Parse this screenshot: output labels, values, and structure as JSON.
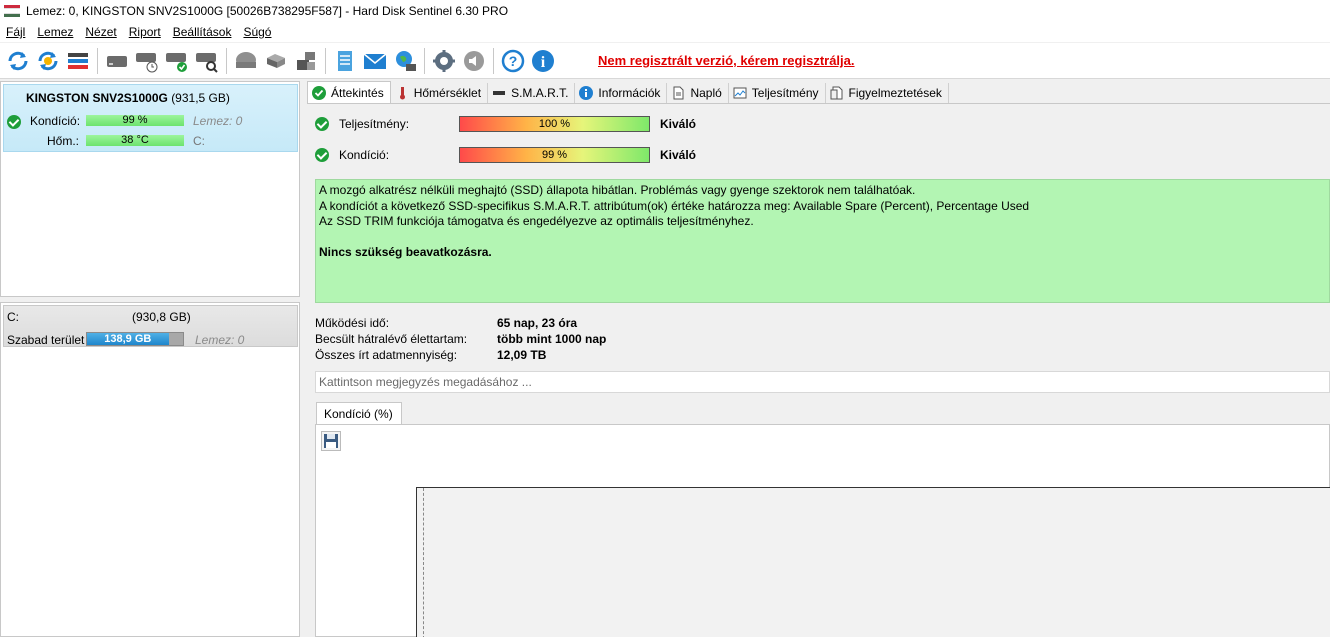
{
  "window": {
    "title": "Lemez: 0, KINGSTON SNV2S1000G [50026B738295F587]  -  Hard Disk Sentinel 6.30 PRO",
    "flag_colors": [
      "#cd2a3e",
      "#ffffff",
      "#436f4d"
    ]
  },
  "menu": [
    "Fájl",
    "Lemez",
    "Nézet",
    "Riport",
    "Beállítások",
    "Súgó"
  ],
  "toolbar": {
    "buttons": [
      "refresh-icon",
      "refresh-all-icon",
      "disk-list-icon",
      "hdd-icon",
      "hdd-clock-icon",
      "hdd-check-icon",
      "hdd-search-icon",
      "hdd-gray-icon",
      "drive-icon",
      "drive-stack-icon",
      "notepad-icon",
      "mail-icon",
      "network-icon",
      "settings-icon",
      "sound-icon",
      "help-icon",
      "info-icon"
    ],
    "registration_notice": "Nem regisztrált verzió, kérem regisztrálja."
  },
  "disk_panel": {
    "name": "KINGSTON SNV2S1000G",
    "size": "(931,5 GB)",
    "health_label": "Kondíció:",
    "health_value": "99 %",
    "health_disk": "Lemez: 0",
    "temp_label": "Hőm.:",
    "temp_value": "38 °C",
    "temp_drive": "C:"
  },
  "volume_panel": {
    "drive": "C:",
    "size": "(930,8 GB)",
    "free_label": "Szabad terület",
    "free_value": "138,9 GB",
    "free_disk": "Lemez: 0",
    "free_fraction": 0.85
  },
  "tabs": [
    {
      "label": "Áttekintés",
      "icon": "check-icon"
    },
    {
      "label": "Hőmérséklet",
      "icon": "thermometer-icon"
    },
    {
      "label": "S.M.A.R.T.",
      "icon": "smart-icon"
    },
    {
      "label": "Információk",
      "icon": "info-icon"
    },
    {
      "label": "Napló",
      "icon": "log-icon"
    },
    {
      "label": "Teljesítmény",
      "icon": "performance-icon"
    },
    {
      "label": "Figyelmeztetések",
      "icon": "alerts-icon"
    }
  ],
  "overview": {
    "performance_label": "Teljesítmény:",
    "performance_value": "100 %",
    "performance_rating": "Kiváló",
    "health_label": "Kondíció:",
    "health_value": "99 %",
    "health_rating": "Kiváló",
    "message_lines": [
      "A mozgó alkatrész nélküli meghajtó (SSD) állapota hibátlan. Problémás vagy gyenge szektorok nem találhatóak.",
      "A kondíciót a következő SSD-specifikus S.M.A.R.T. attribútum(ok) értéke határozza meg:  Available Spare (Percent), Percentage Used",
      "Az SSD TRIM funkciója támogatva és engedélyezve az optimális teljesítményhez."
    ],
    "message_bold": "Nincs szükség beavatkozásra.",
    "message_color": "#b3f5b3",
    "info": [
      {
        "key": "Működési idő:",
        "value": "65 nap, 23 óra"
      },
      {
        "key": "Becsült hátralévő élettartam:",
        "value": "több mint 1000 nap"
      },
      {
        "key": "Összes írt adatmennyiség:",
        "value": "12,09 TB"
      }
    ],
    "note_placeholder": "Kattintson megjegyzés megadásához ...",
    "chart_tab": "Kondíció  (%)"
  }
}
